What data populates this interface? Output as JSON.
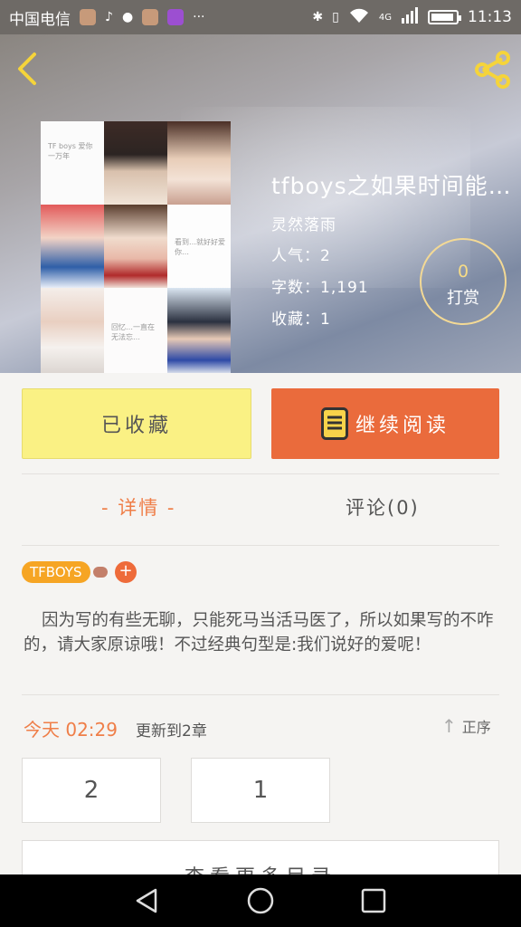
{
  "status_bar": {
    "carrier": "中国电信",
    "time": "11:13",
    "network": "4G"
  },
  "book": {
    "title": "tfboys之如果时间能…",
    "author": "灵然落雨",
    "popularity": "人气：2",
    "word_count": "字数：1,191",
    "favorites": "收藏：1",
    "tip_count": "0",
    "tip_label": "打赏",
    "cover_texts": {
      "t1": "TF boys 爱你 一万年",
      "t6": "看到…就好好爱你…",
      "t8": "回忆…一直在 无法忘…"
    }
  },
  "actions": {
    "collect_label": "已收藏",
    "read_label": "继续阅读"
  },
  "tabs": {
    "details": "- 详情 -",
    "comments": "评论(0)"
  },
  "tags": {
    "primary": "TFBOYS",
    "add": "+"
  },
  "description": "因为写的有些无聊，只能死马当活马医了，所以如果写的不咋的，请大家原谅哦！不过经典句型是:我们说好的爱呢！",
  "update": {
    "time": "今天 02:29",
    "text": "更新到2章",
    "sort_label": "正序"
  },
  "chapters": [
    "2",
    "1"
  ],
  "catalog_label": "查看更多目录",
  "colors": {
    "accent_orange": "#ea6b3c",
    "collect_yellow": "#faf184",
    "tag_orange": "#f6a524"
  }
}
